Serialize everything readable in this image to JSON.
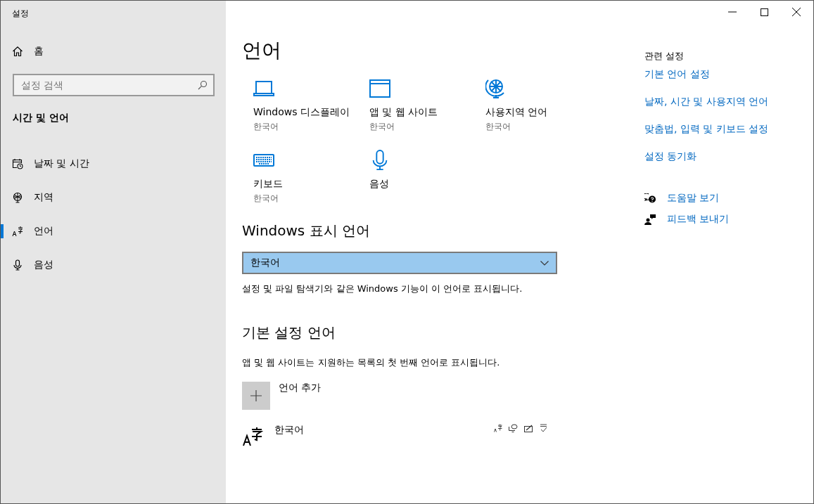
{
  "window": {
    "title": "설정"
  },
  "sidebar": {
    "home": "홈",
    "search": {
      "placeholder": "설정 검색"
    },
    "section": "시간 및 언어",
    "items": [
      {
        "kind": "datetime",
        "label": "날짜 및 시간",
        "selected": false
      },
      {
        "kind": "region",
        "label": "지역",
        "selected": false
      },
      {
        "kind": "language",
        "label": "언어",
        "selected": true
      },
      {
        "kind": "speech",
        "label": "음성",
        "selected": false
      }
    ]
  },
  "main": {
    "title": "언어",
    "tiles": [
      {
        "kind": "display",
        "label": "Windows 디스플레이",
        "sublabel": "한국어"
      },
      {
        "kind": "apps",
        "label": "앱 및 웹 사이트",
        "sublabel": "한국어"
      },
      {
        "kind": "regional",
        "label": "사용지역 언어",
        "sublabel": "한국어"
      },
      {
        "kind": "keyboard",
        "label": "키보드",
        "sublabel": "한국어"
      },
      {
        "kind": "speech",
        "label": "음성"
      }
    ],
    "display_language": {
      "heading": "Windows 표시 언어",
      "value": "한국어",
      "description": "설정 및 파일 탐색기와 같은 Windows 기능이 이 언어로 표시됩니다."
    },
    "preferred": {
      "heading": "기본 설정 언어",
      "description": "앱 및 웹 사이트는 지원하는 목록의 첫 번째 언어로 표시됩니다.",
      "add_label": "언어 추가",
      "languages": [
        {
          "name": "한국어"
        }
      ]
    }
  },
  "related": {
    "heading": "관련 설정",
    "links": [
      "기본 언어 설정",
      "날짜, 시간 및 사용지역 언어",
      "맞춤법, 입력 및 키보드 설정",
      "설정 동기화"
    ],
    "help": [
      {
        "kind": "help",
        "label": "도움말 보기"
      },
      {
        "kind": "feedback",
        "label": "피드백 보내기"
      }
    ]
  }
}
